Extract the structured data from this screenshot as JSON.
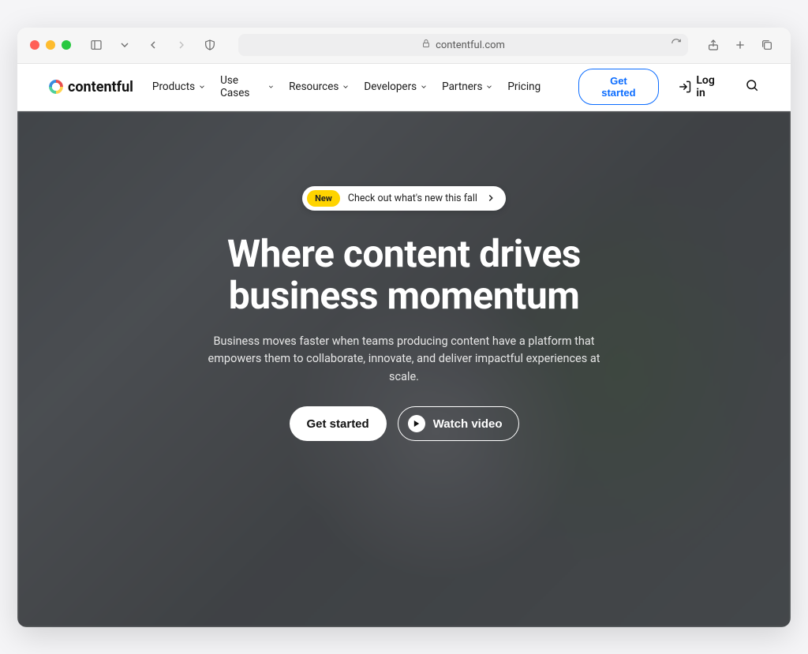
{
  "browser": {
    "url_display": "contentful.com"
  },
  "header": {
    "brand": "contentful",
    "nav": [
      {
        "label": "Products",
        "dropdown": true
      },
      {
        "label": "Use Cases",
        "dropdown": true
      },
      {
        "label": "Resources",
        "dropdown": true
      },
      {
        "label": "Developers",
        "dropdown": true
      },
      {
        "label": "Partners",
        "dropdown": true
      },
      {
        "label": "Pricing",
        "dropdown": false
      }
    ],
    "cta": "Get started",
    "login": "Log in"
  },
  "hero": {
    "announce_badge": "New",
    "announce_text": "Check out what's new this fall",
    "title_line1": "Where content drives",
    "title_line2": "business momentum",
    "subtitle": "Business moves faster when teams producing content have a platform that empowers them to collaborate, innovate, and deliver impactful experiences at scale.",
    "primary_cta": "Get started",
    "secondary_cta": "Watch video"
  }
}
